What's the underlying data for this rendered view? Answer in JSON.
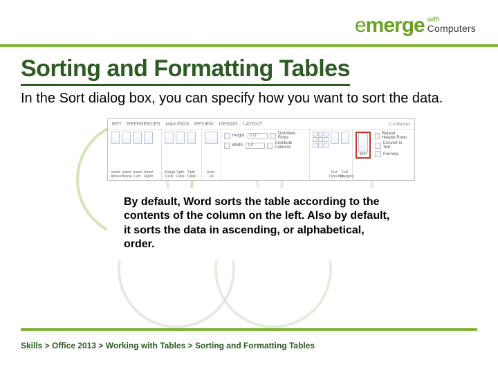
{
  "logo": {
    "plain": "e",
    "bold": "merge",
    "with": "with",
    "computers": "Computers"
  },
  "title": "Sorting and Formatting Tables",
  "intro": "In the Sort dialog box, you can specify how you want to sort the data.",
  "ribbon": {
    "tabs": [
      "ERT",
      "REFERENCES",
      "MAILINGS",
      "REVIEW",
      "DESIGN",
      "LAYOUT"
    ],
    "signin": "C.A.Barnes",
    "rows_group": {
      "insert_above": "Insert Above",
      "insert_below": "Insert Below",
      "insert_left": "Insert Left",
      "insert_right": "Insert Right"
    },
    "merge_group": {
      "merge": "Merge Cells",
      "split": "Split Cells",
      "split_table": "Split Table"
    },
    "autofit": "Auto-Fit",
    "cellsize": {
      "height_label": "Height:",
      "height_val": "0.21\"",
      "width_label": "Width:",
      "width_val": "1.5\"",
      "dist_rows": "Distribute Rows",
      "dist_cols": "Distribute Columns"
    },
    "align": {
      "text_dir": "Text Direction",
      "cell_margins": "Cell Margins"
    },
    "data": {
      "sort": "Sort",
      "repeat": "Repeat Header Rows",
      "convert": "Convert to Text",
      "formula": "Formula"
    }
  },
  "explain": "By default, Word sorts the table according to the contents of the column on the left. Also by default, it sorts the data in ascending, or alphabetical, order.",
  "breadcrumb": "Skills > Office 2013 > Working with Tables > Sorting and Formatting Tables"
}
